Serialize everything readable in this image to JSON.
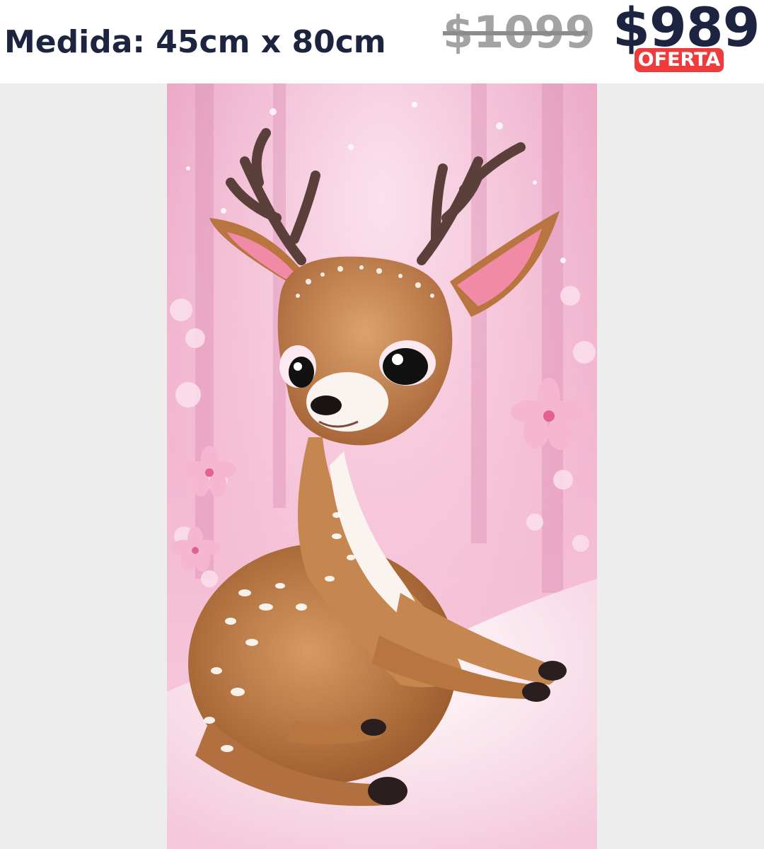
{
  "listing": {
    "size_label": "Medida: 45cm x 80cm",
    "original_price": "$1099",
    "sale_price": "$989",
    "badge": "OFERTA"
  },
  "colors": {
    "text_dark": "#1c2440",
    "old_price_gray": "#a3a3a3",
    "badge_red": "#ef3b3b",
    "background": "#ededed",
    "art_pink": "#f0a9c8",
    "fawn_brown": "#b8753f"
  },
  "image": {
    "subject": "fawn-painting"
  }
}
